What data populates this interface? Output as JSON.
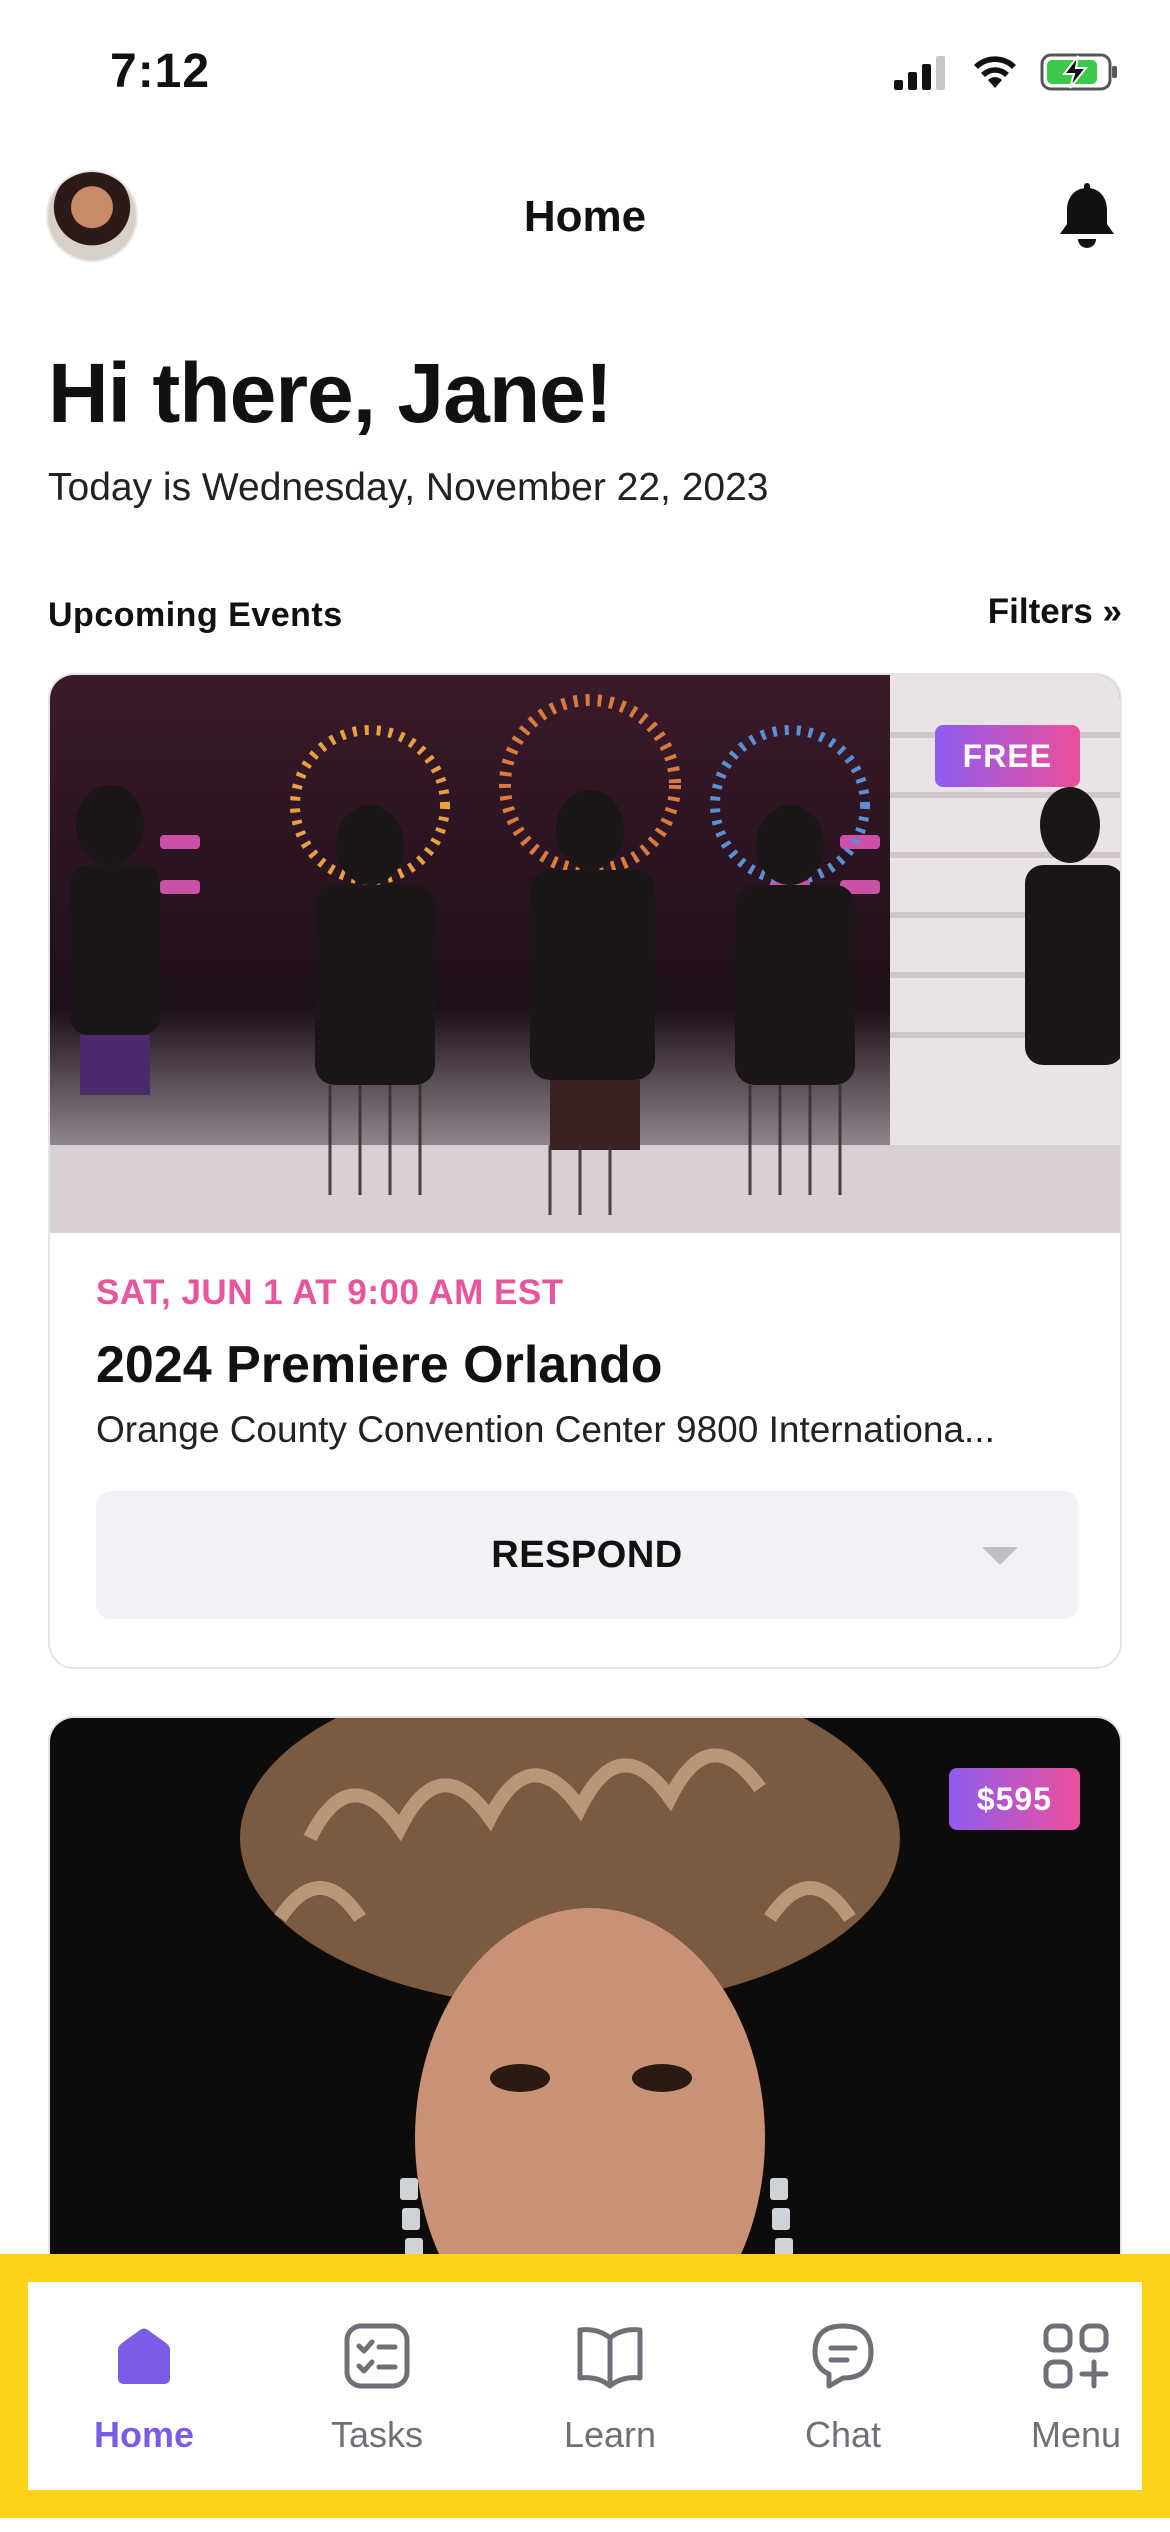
{
  "status_bar": {
    "time": "7:12"
  },
  "header": {
    "title": "Home"
  },
  "greeting": {
    "headline": "Hi there, Jane!",
    "date_line": "Today is Wednesday, November 22, 2023"
  },
  "section": {
    "title": "Upcoming Events",
    "filters_label": "Filters »"
  },
  "events": [
    {
      "price": "FREE",
      "date": "SAT, JUN 1 AT 9:00 AM EST",
      "title": "2024 Premiere Orlando",
      "venue": "Orange County Convention Center 9800 Internationa...",
      "respond_label": "RESPOND"
    },
    {
      "price": "$595"
    }
  ],
  "tabs": [
    {
      "label": "Home",
      "icon": "home-icon",
      "active": true
    },
    {
      "label": "Tasks",
      "icon": "tasks-icon",
      "active": false
    },
    {
      "label": "Learn",
      "icon": "book-icon",
      "active": false
    },
    {
      "label": "Chat",
      "icon": "chat-icon",
      "active": false
    },
    {
      "label": "Menu",
      "icon": "menu-grid-icon",
      "active": false
    }
  ],
  "colors": {
    "accent_pink": "#e8559e",
    "accent_purple": "#7b5ce6",
    "badge_gradient_start": "#8f5cf0",
    "badge_gradient_end": "#ec4f9a",
    "tab_bar_highlight": "#ffd21a"
  }
}
